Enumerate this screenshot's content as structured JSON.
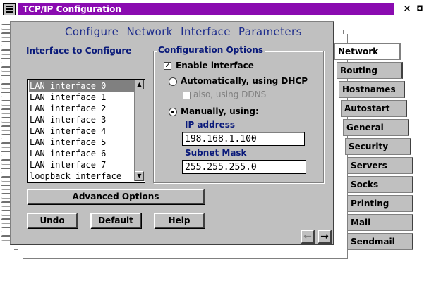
{
  "window": {
    "title": "TCP/IP Configuration",
    "title_color": "#8a0bb0"
  },
  "page": {
    "heading": "Configure Network Interface Parameters",
    "interface_label": "Interface to Configure",
    "interfaces": [
      "LAN interface 0",
      "LAN interface 1",
      "LAN interface 2",
      "LAN interface 3",
      "LAN interface 4",
      "LAN interface 5",
      "LAN interface 6",
      "LAN interface 7",
      "loopback interface"
    ],
    "selected_interface": "LAN interface 0"
  },
  "options": {
    "group_title": "Configuration Options",
    "enable_label": "Enable interface",
    "enable_checked": true,
    "dhcp_label": "Automatically, using DHCP",
    "ddns_label": "also, using DDNS",
    "manual_label": "Manually, using:",
    "ip_label": "IP address",
    "ip_value": "198.168.1.100",
    "mask_label": "Subnet Mask",
    "mask_value": "255.255.255.0"
  },
  "buttons": {
    "advanced": "Advanced Options",
    "undo": "Undo",
    "default": "Default",
    "help": "Help"
  },
  "tabs": [
    "Network",
    "Routing",
    "Hostnames",
    "Autostart",
    "General",
    "Security",
    "Servers",
    "Socks",
    "Printing",
    "Mail",
    "Sendmail"
  ]
}
